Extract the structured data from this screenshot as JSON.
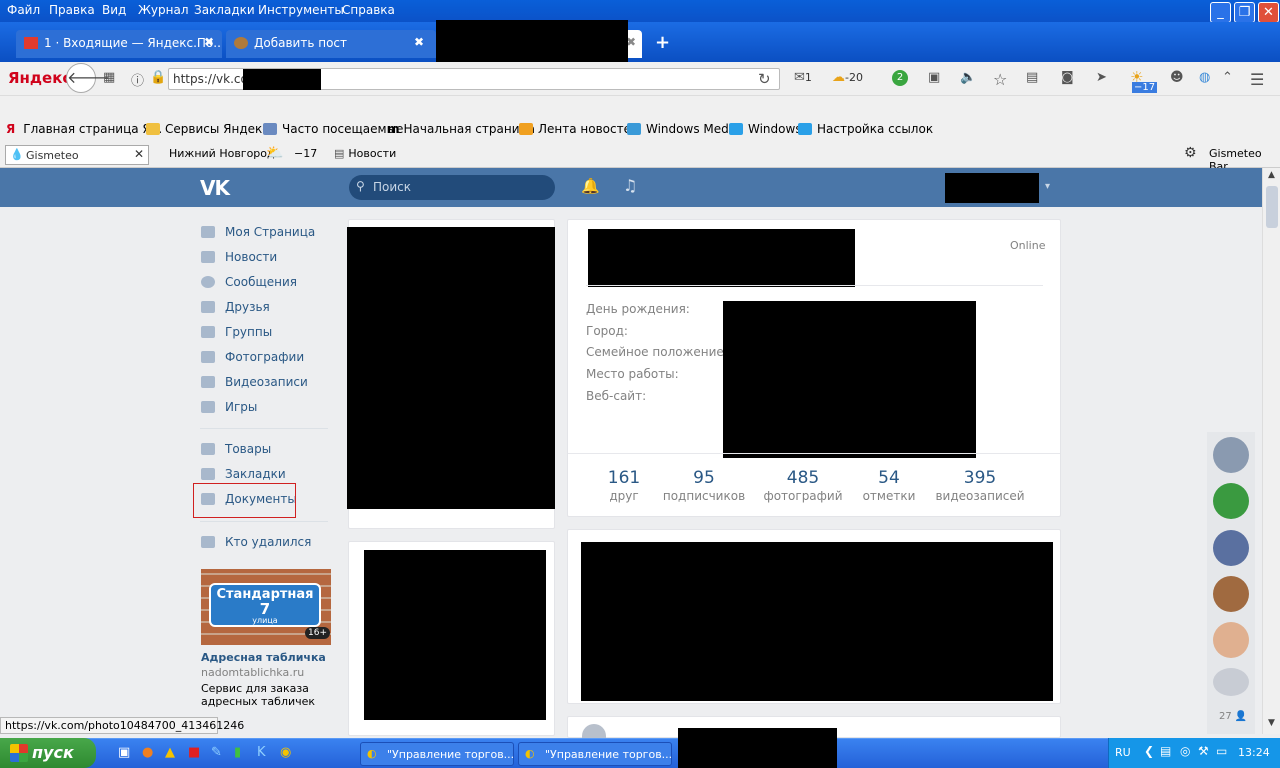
{
  "menu": [
    "Файл",
    "Правка",
    "Вид",
    "Журнал",
    "Закладки",
    "Инструменты",
    "Справка"
  ],
  "tabs": [
    {
      "label": "1 · Входящие — Яндекс.По...",
      "close": "✖"
    },
    {
      "label": "Добавить пост",
      "close": "✖"
    }
  ],
  "tab_close": "✖",
  "tab_new": "+",
  "browser_brand": "Яндекс",
  "url": "https://vk.com",
  "nav_badges": {
    "mail": "1",
    "weather": "-20",
    "counter": "2",
    "weather_badge": "−17"
  },
  "bookmarks": [
    "Главная страница Я...",
    "Сервисы Яндекса",
    "Часто посещаемые",
    "Начальная страница",
    "Лента новостей",
    "Windows Media",
    "Windows",
    "Настройка ссылок"
  ],
  "gismeteo": {
    "input": "Gismeteo",
    "city": "Нижний Новгород",
    "temp": "−17",
    "news": "Новости",
    "bar": "Gismeteo Bar"
  },
  "vk": {
    "logo": "VK",
    "search_placeholder": "Поиск",
    "menu": [
      "Моя Страница",
      "Новости",
      "Сообщения",
      "Друзья",
      "Группы",
      "Фотографии",
      "Видеозаписи",
      "Игры"
    ],
    "menu2": [
      "Товары",
      "Закладки",
      "Документы"
    ],
    "menu3": [
      "Кто удалился"
    ],
    "ad": {
      "sign_line1": "Стандартная",
      "sign_number": "7",
      "sign_line2": "улица",
      "age": "16+",
      "title": "Адресная табличка",
      "domain": "nadomtablichka.ru",
      "desc": "Сервис для заказа адресных табличек"
    },
    "profile": {
      "status": "Online",
      "labels": [
        "День рождения:",
        "Город:",
        "Семейное положение:",
        "Место работы:",
        "Веб-сайт:"
      ],
      "counters": [
        {
          "n": "161",
          "t": "друг"
        },
        {
          "n": "95",
          "t": "подписчиков"
        },
        {
          "n": "485",
          "t": "фотографий"
        },
        {
          "n": "54",
          "t": "отметки"
        },
        {
          "n": "395",
          "t": "видеозаписей"
        }
      ]
    },
    "friends_count": "27"
  },
  "status_url": "https://vk.com/photo10484700_413461246",
  "taskbar": {
    "start": "пуск",
    "tasks": [
      "\"Управление торгов...",
      "\"Управление торгов..."
    ],
    "lang": "RU",
    "clock": "13:24"
  }
}
